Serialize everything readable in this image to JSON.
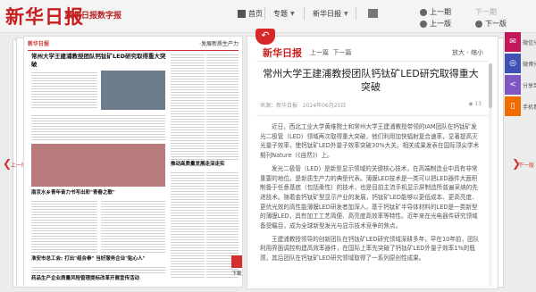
{
  "header": {
    "logo": "新华日报",
    "logo_sub": "新华日报数字报",
    "nav": {
      "home": "首页",
      "column": "专题",
      "paper": "新华日报"
    },
    "prev_page": "上一期",
    "next_page": "下一期",
    "prev_edition": "上一版",
    "next_edition": "下一版"
  },
  "left_page": {
    "masthead": "新华日报",
    "edition": "·发展新质生产力",
    "headline": "常州大学王建浦教授团队钙钛矿LED研究取得重大突破",
    "items": [
      "南京水乡青年奋力书写出彩\"青春之歌\"",
      "推动高质量发展走深走实",
      "淮安市总工会: 打出\"组合拳\" 当好服务企业\"贴心人\"",
      "药品生产企业质量风险管理提标改革开展宣传活动"
    ]
  },
  "article": {
    "logo": "新华日报",
    "prev": "上一篇",
    "next": "下一篇",
    "tools": "放大 - 缩小",
    "title": "常州大学王建浦教授团队钙钛矿LED研究取得重大突破",
    "source": "来源：新华日报",
    "date": "2024年06月25日",
    "views": "13",
    "paragraphs": [
      "近日，西北工业大学黄维院士和常州大学王建浦教授带领的IAM团队在钙钛矿发光二极管（LED）领域再次取得重大突破，他们利用加快辐射复合速率，显著提高灭光量子效率，使钙钛矿LED外量子效率突破30%大关。相关成果发表在国际顶尖学术期刊Nature（《自然》）上。",
      "发光二极管（LED）是新型显示领域的关键核心技术，在高端制造业中具有非常重要的地位。是新质生产力的典型代表。薄膜LED技术是一类可以把LED器件大面积制备于任意基底（包括柔性）的技术，也是目前主流手机显示屏制造所普遍采纳的先进技术。随着金钙钛矿型显示产业的发展，钙钛矿LED能够以更低成本、更高亮度、更优光效的高性能薄膜LED研发者加深入，基于钙钛矿半导体材料的LED是一类新型的薄膜LED，具有加工工艺简便、高亮度高效率等特性。近年来在光电器件研究领域备受瞩目，成为全球新型发光与显示技术竞争的焦点。",
      "王建浦教授领导的创新团队在钙钛矿LED研究领域深耕多年，早在10年前，团队利用界面调控构建高效率器件，在国际上率先突破了钙钛矿LED外量子效率1%的瓶颈，其后团队在钙钛矿LED研究领域取得了一系列原创性成果。"
    ]
  },
  "pdf_label": "下载",
  "side": {
    "prev": "上一版",
    "next": "下一版"
  },
  "share": {
    "labels": [
      "微信分享",
      "微博分享",
      "分享到",
      "手机看报"
    ],
    "colors": [
      "#c2185b",
      "#3f51b5",
      "#7e57c2",
      "#ef6c00"
    ]
  }
}
